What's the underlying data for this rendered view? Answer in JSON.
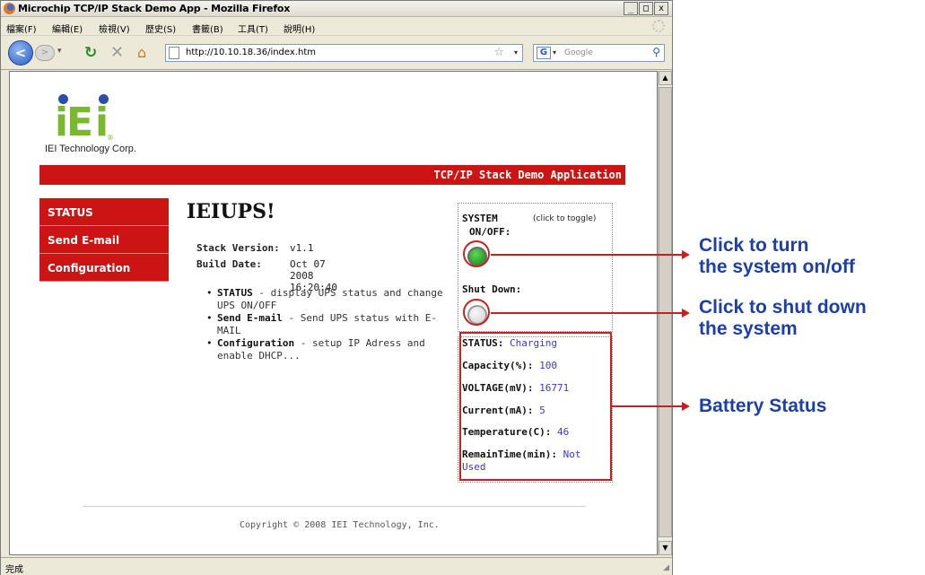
{
  "window": {
    "title": "Microchip TCP/IP Stack Demo App - Mozilla Firefox",
    "buttons": {
      "minimize": "_",
      "maximize": "□",
      "close": "x"
    }
  },
  "menubar": {
    "items": [
      "檔案(F)",
      "編輯(E)",
      "檢視(V)",
      "歷史(S)",
      "書籤(B)",
      "工具(T)",
      "說明(H)"
    ]
  },
  "navbar": {
    "back": "<",
    "forward": ">",
    "url": "http://10.10.18.36/index.htm",
    "search_engine": "G",
    "search_placeholder": "Google"
  },
  "page": {
    "company": "IEI Technology Corp.",
    "logo_letters": "iEi",
    "logo_reg": "®",
    "banner_title": "TCP/IP Stack Demo Application",
    "nav": [
      "STATUS",
      "Send E-mail",
      "Configuration"
    ],
    "heading": "IEIUPS!",
    "stack_version_label": "Stack Version:",
    "stack_version": "v1.1",
    "build_date_label": "Build Date:",
    "build_date": "Oct 07 2008 16:20:40",
    "bullets": [
      {
        "term": "STATUS",
        "desc": " - display UPS status and change UPS ON/OFF"
      },
      {
        "term": "Send E-mail",
        "desc": " - Send UPS status with E-MAIL"
      },
      {
        "term": "Configuration",
        "desc": " - setup IP Adress and enable DHCP..."
      }
    ],
    "system_label_1": "SYSTEM",
    "system_label_2": "ON/OFF:",
    "toggle_hint": "(click to toggle)",
    "shutdown_label": "Shut Down:",
    "system_led_state": "on",
    "shutdown_led_state": "off",
    "status": [
      {
        "key": "STATUS:",
        "value": "Charging"
      },
      {
        "key": "Capacity(%):",
        "value": "100"
      },
      {
        "key": "VOLTAGE(mV):",
        "value": "16771"
      },
      {
        "key": "Current(mA):",
        "value": "5"
      },
      {
        "key": "Temperature(C):",
        "value": "46"
      },
      {
        "key": "RemainTime(min):",
        "value": "Not Used"
      }
    ],
    "copyright": "Copyright © 2008 IEI Technology, Inc."
  },
  "statusbar": {
    "text": "完成"
  },
  "annotations": {
    "toggle_line1": "Click to turn",
    "toggle_line2": "the system on/off",
    "shutdown_line1": "Click to shut down",
    "shutdown_line2": "the system",
    "battery": "Battery Status"
  },
  "colors": {
    "accent_red": "#cc1414",
    "annotation_red": "#c82020",
    "annotation_blue": "#1c3fa8",
    "value_blue": "#3a3ad0",
    "logo_green": "#7ab82e"
  }
}
